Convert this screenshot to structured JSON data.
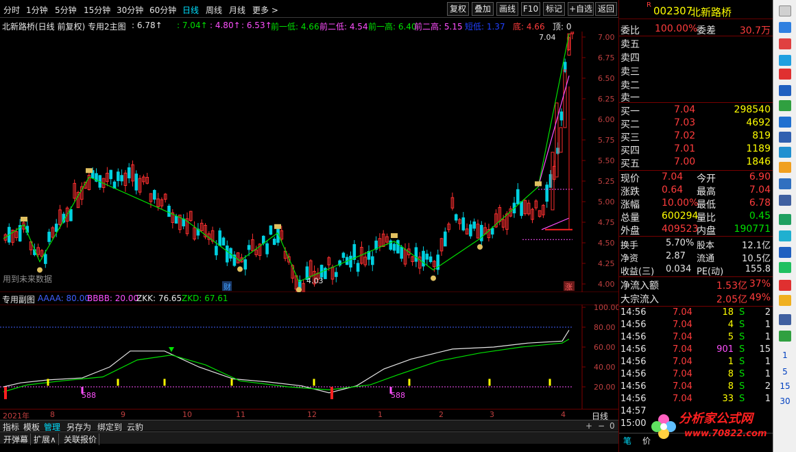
{
  "toolbar": {
    "periods": [
      "分时",
      "1分钟",
      "5分钟",
      "15分钟",
      "30分钟",
      "60分钟",
      "日线",
      "周线",
      "月线",
      "更多 >"
    ],
    "active_period": "日线",
    "buttons": [
      "复权",
      "叠加",
      "画线",
      "F10",
      "标记",
      "+自选",
      "返回"
    ]
  },
  "main_header": {
    "title": "北新路桥(日线 前复权) 专用2主图",
    "items": [
      {
        "text": ": 6.78↑",
        "color": "#e6e6e6"
      },
      {
        "text": ": 7.04↑",
        "color": "#00e000"
      },
      {
        "text": ": 4.80↑",
        "color": "#ff50ff"
      },
      {
        "text": ": 6.53↑",
        "color": "#ff50ff"
      },
      {
        "text": "前一低: 4.66",
        "color": "#00e000"
      },
      {
        "text": "前二低: 4.54",
        "color": "#ff50ff"
      },
      {
        "text": "前一高: 6.40",
        "color": "#00e000"
      },
      {
        "text": "前二高: 5.15",
        "color": "#ff50ff"
      },
      {
        "text": "短低: 1.37",
        "color": "#2040ff"
      },
      {
        "text": "底: 4.66",
        "color": "#ff3c3c"
      },
      {
        "text": "顶: 0",
        "color": "#e6e6e6"
      }
    ]
  },
  "main_chart": {
    "price_axis": [
      "7.00",
      "6.75",
      "6.50",
      "6.25",
      "6.00",
      "5.75",
      "5.50",
      "5.25",
      "5.00",
      "4.75",
      "4.50",
      "4.25",
      "4.00"
    ],
    "annotations": {
      "top": "7.04",
      "low": "4.03",
      "note": "用到未来数据",
      "caiwu": "财",
      "zhang": "涨"
    }
  },
  "sub_header": {
    "title": "专用副图",
    "items": [
      {
        "text": "AAAA: 80.00",
        "color": "#4060ff"
      },
      {
        "text": "BBBB: 20.00",
        "color": "#ff50ff"
      },
      {
        "text": "ZKK: 76.65",
        "color": "#e6e6e6"
      },
      {
        "text": "ZKD: 67.61",
        "color": "#00e000"
      }
    ]
  },
  "sub_chart": {
    "axis": [
      "100.00",
      "80.00",
      "60.00",
      "40.00",
      "20.00"
    ],
    "labels": [
      "588",
      "588"
    ]
  },
  "date_axis": [
    "2021年",
    "8",
    "9",
    "10",
    "11",
    "12",
    "1",
    "2",
    "3",
    "4"
  ],
  "date_axis_right": "日线",
  "bottom_tabs": [
    "指标",
    "模板",
    "管理",
    "另存为",
    "绑定到",
    "云豹"
  ],
  "bottom_tabs_active": "管理",
  "bottom_tabs2": [
    "开弹幕",
    "扩展∧",
    "关联报价"
  ],
  "quote": {
    "code": "002307",
    "name": "北新路桥",
    "r_mark": "R",
    "weibi_label": "委比",
    "weibi": "100.00%",
    "weicha_label": "委差",
    "weicha": "30.7万",
    "sell": [
      {
        "label": "卖五",
        "price": "",
        "vol": ""
      },
      {
        "label": "卖四",
        "price": "",
        "vol": ""
      },
      {
        "label": "卖三",
        "price": "",
        "vol": ""
      },
      {
        "label": "卖二",
        "price": "",
        "vol": ""
      },
      {
        "label": "卖一",
        "price": "",
        "vol": ""
      }
    ],
    "buy": [
      {
        "label": "买一",
        "price": "7.04",
        "vol": "298540"
      },
      {
        "label": "买二",
        "price": "7.03",
        "vol": "4692"
      },
      {
        "label": "买三",
        "price": "7.02",
        "vol": "819"
      },
      {
        "label": "买四",
        "price": "7.01",
        "vol": "1189"
      },
      {
        "label": "买五",
        "price": "7.00",
        "vol": "1846"
      }
    ],
    "stats": [
      {
        "l1": "现价",
        "v1": "7.04",
        "c1": "#ff3c3c",
        "l2": "今开",
        "v2": "6.90",
        "c2": "#ff3c3c"
      },
      {
        "l1": "涨跌",
        "v1": "0.64",
        "c1": "#ff3c3c",
        "l2": "最高",
        "v2": "7.04",
        "c2": "#ff3c3c"
      },
      {
        "l1": "涨幅",
        "v1": "10.00%",
        "c1": "#ff3c3c",
        "l2": "最低",
        "v2": "6.78",
        "c2": "#ff3c3c"
      },
      {
        "l1": "总量",
        "v1": "600294",
        "c1": "#ffff00",
        "l2": "量比",
        "v2": "0.45",
        "c2": "#00e000"
      },
      {
        "l1": "外盘",
        "v1": "409523",
        "c1": "#ff3c3c",
        "l2": "内盘",
        "v2": "190771",
        "c2": "#00e000"
      }
    ],
    "stats2": [
      {
        "l1": "换手",
        "v1": "5.70%",
        "l2": "股本",
        "v2": "12.1亿"
      },
      {
        "l1": "净资",
        "v1": "2.87",
        "l2": "流通",
        "v2": "10.5亿"
      },
      {
        "l1": "收益(三)",
        "v1": "0.034",
        "l2": "PE(动)",
        "v2": "155.8"
      }
    ],
    "flow": [
      {
        "label": "净流入额",
        "value": "1.53亿",
        "pct": "37%"
      },
      {
        "label": "大宗流入",
        "value": "2.05亿",
        "pct": "49%"
      }
    ],
    "ticks": [
      {
        "t": "14:56",
        "p": "7.04",
        "v": "18",
        "vc": "#ffff00",
        "s": "S",
        "n": "2"
      },
      {
        "t": "14:56",
        "p": "7.04",
        "v": "4",
        "vc": "#ffff00",
        "s": "S",
        "n": "1"
      },
      {
        "t": "14:56",
        "p": "7.04",
        "v": "5",
        "vc": "#ffff00",
        "s": "S",
        "n": "1"
      },
      {
        "t": "14:56",
        "p": "7.04",
        "v": "901",
        "vc": "#ff50ff",
        "s": "S",
        "n": "15"
      },
      {
        "t": "14:56",
        "p": "7.04",
        "v": "1",
        "vc": "#ffff00",
        "s": "S",
        "n": "1"
      },
      {
        "t": "14:56",
        "p": "7.04",
        "v": "8",
        "vc": "#ffff00",
        "s": "S",
        "n": "1"
      },
      {
        "t": "14:56",
        "p": "7.04",
        "v": "8",
        "vc": "#ffff00",
        "s": "S",
        "n": "2"
      },
      {
        "t": "14:56",
        "p": "7.04",
        "v": "33",
        "vc": "#ffff00",
        "s": "S",
        "n": "1"
      },
      {
        "t": "14:57",
        "p": "",
        "v": "",
        "vc": "#ffff00",
        "s": "",
        "n": ""
      },
      {
        "t": "15:00",
        "p": "",
        "v": "",
        "vc": "#ffff00",
        "s": "",
        "n": ""
      }
    ],
    "bottom_tabs": [
      "笔",
      "价"
    ]
  },
  "sidebar_numbers": [
    "1",
    "5",
    "15",
    "30"
  ],
  "watermark": {
    "text": "分析家公式网",
    "url": "www.70822.com"
  }
}
